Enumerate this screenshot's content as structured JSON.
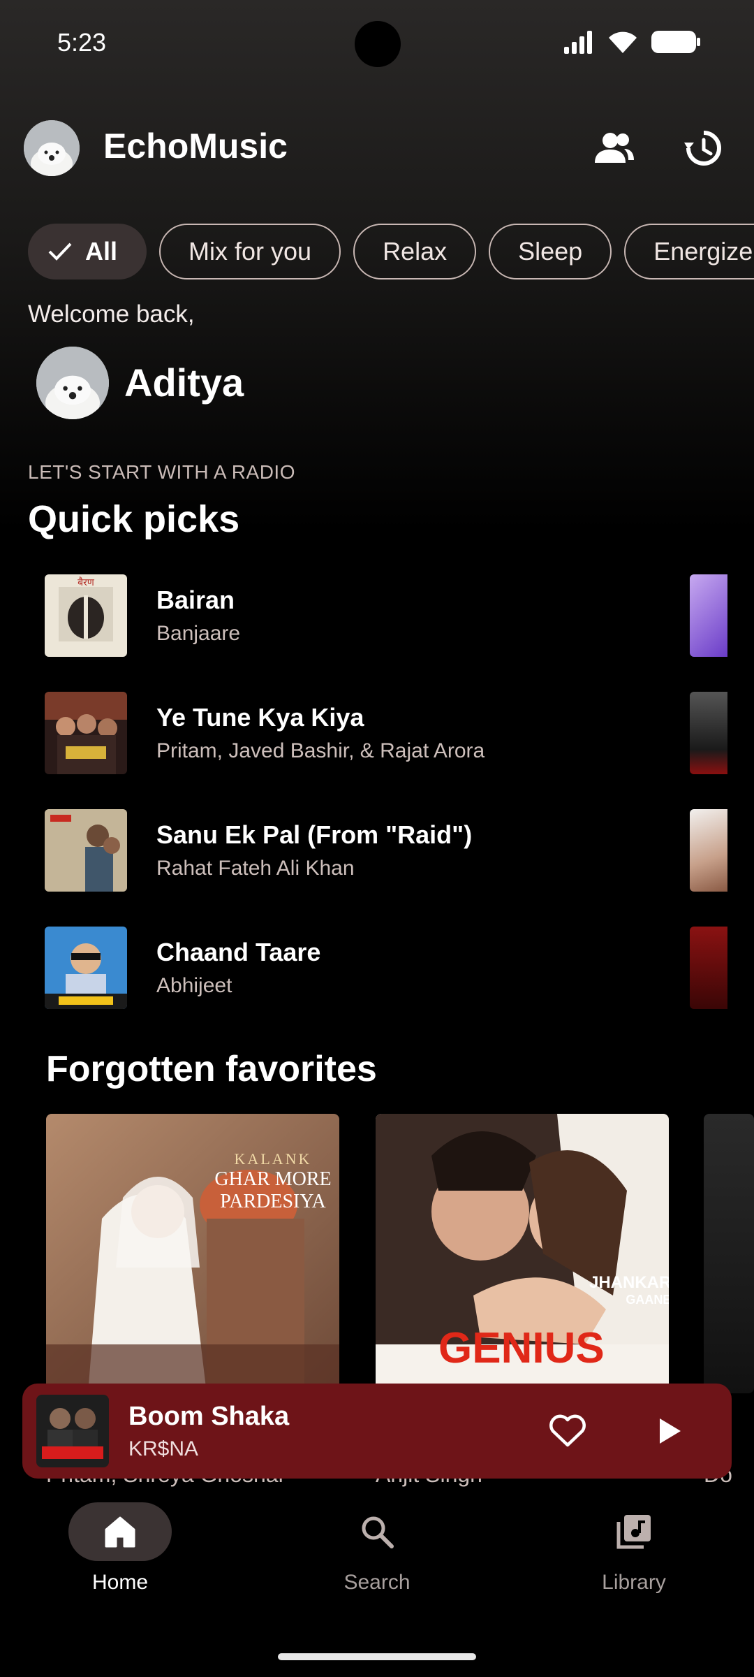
{
  "status_bar": {
    "time": "5:23"
  },
  "header": {
    "app_title": "EchoMusic"
  },
  "chips": [
    {
      "label": "All",
      "selected": true
    },
    {
      "label": "Mix for you",
      "selected": false
    },
    {
      "label": "Relax",
      "selected": false
    },
    {
      "label": "Sleep",
      "selected": false
    },
    {
      "label": "Energize",
      "selected": false
    }
  ],
  "welcome": {
    "greeting": "Welcome back,",
    "user_name": "Aditya"
  },
  "quick_picks": {
    "subtitle": "LET'S START WITH A RADIO",
    "title": "Quick picks",
    "items": [
      {
        "title": "Bairan",
        "artist": "Banjaare"
      },
      {
        "title": "Ye Tune Kya Kiya",
        "artist": "Pritam, Javed Bashir, & Rajat Arora"
      },
      {
        "title": "Sanu Ek Pal (From \"Raid\")",
        "artist": "Rahat Fateh Ali Khan"
      },
      {
        "title": "Chaand Taare",
        "artist": "Abhijeet"
      }
    ]
  },
  "forgotten_favorites": {
    "title": "Forgotten favorites",
    "cards": [
      {
        "art_text_1": "KALANK",
        "art_text_2": "GHAR MORE",
        "art_text_3": "PARDESIYA",
        "caption": "Pritam, Shreya Ghoshal"
      },
      {
        "art_text_1": "GENIUS",
        "art_text_2": "JHANKAR",
        "art_text_3": "GAANE",
        "caption": "Arijit Singh"
      },
      {
        "caption": "Do"
      }
    ]
  },
  "mini_player": {
    "title": "Boom Shaka",
    "artist": "KR$NA",
    "art_text": "BOOM SHAKA"
  },
  "bottom_nav": [
    {
      "label": "Home",
      "active": true
    },
    {
      "label": "Search",
      "active": false
    },
    {
      "label": "Library",
      "active": false
    }
  ],
  "colors": {
    "mini_player_bg": "#6e1418",
    "chip_selected_bg": "#3a3232",
    "nav_active_pill": "#3b3333"
  }
}
